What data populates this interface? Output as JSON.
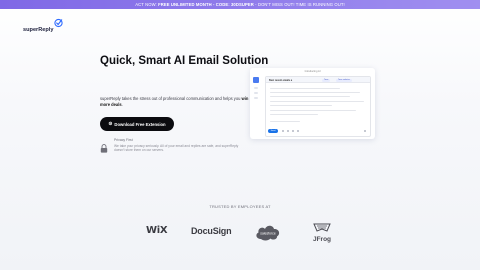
{
  "promo": {
    "text_lead": "ACT NOW: ",
    "text_offer": "FREE UNLIMITED MONTH - CODE: 30DSUPER",
    "text_tail": " - DON'T MISS OUT! TIME IS RUNNING OUT!"
  },
  "brand": {
    "name": "superReply"
  },
  "hero": {
    "headline": "Quick, Smart AI Email Solution",
    "desc_lead": "superReply takes the stress out of professional communication and helps you ",
    "desc_bold": "win more deals",
    "desc_tail": ".",
    "cta_icon": "⚙",
    "cta_label": "Download Free Extension"
  },
  "privacy": {
    "title": "Privacy First",
    "text": "We take your privacy seriously. All of your email and replies are safe, and superReply doesn't store them on our servers."
  },
  "preview": {
    "title": "Introducing AI",
    "subject": "Best recent emails a",
    "chip_1": "Tone",
    "chip_2": "Tone selector",
    "send": "Send"
  },
  "trusted": {
    "label": "TRUSTED BY EMPLOYEES AT"
  },
  "logos": {
    "wix": "WiX",
    "docusign": "DocuSign",
    "salesforce": "salesforce",
    "jfrog": "JFrog"
  },
  "colors": {
    "promo_start": "#7f68e6",
    "promo_end": "#a08ff0",
    "cta_bg": "#0b0b0f",
    "accent": "#2f6bff"
  }
}
